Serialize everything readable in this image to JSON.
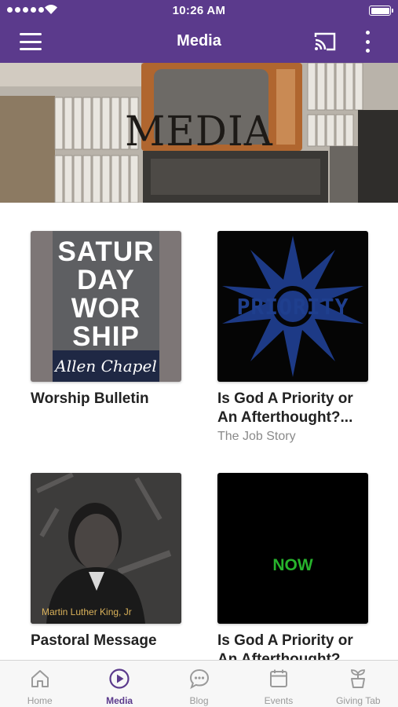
{
  "status_bar": {
    "time": "10:26 AM"
  },
  "nav": {
    "title": "Media",
    "menu_icon": "hamburger-menu-icon",
    "cast_icon": "cast-icon",
    "more_icon": "more-vertical-icon"
  },
  "banner": {
    "title": "MEDIA"
  },
  "items": [
    {
      "title": "Worship Bulletin",
      "subtitle": "",
      "thumb": {
        "line1": "SATUR",
        "line2": "DAY",
        "line3": "WOR",
        "line4": "SHIP",
        "caption": "Allen Chapel"
      }
    },
    {
      "title": "Is God A Priority or An Afterthought?...",
      "subtitle": "The Job Story",
      "thumb": {
        "word": "PRIORITY"
      }
    },
    {
      "title": "Pastoral Message",
      "subtitle": "",
      "thumb": {
        "caption": "Martin Luther King, Jr"
      }
    },
    {
      "title": "Is God A Priority or An Afterthought?...",
      "subtitle": "",
      "thumb": {
        "word": "NOW"
      }
    }
  ],
  "tabs": [
    {
      "label": "Home",
      "icon": "home-icon"
    },
    {
      "label": "Media",
      "icon": "play-circle-icon"
    },
    {
      "label": "Blog",
      "icon": "chat-bubble-icon"
    },
    {
      "label": "Events",
      "icon": "calendar-icon"
    },
    {
      "label": "Giving Tab",
      "icon": "plant-pot-icon"
    }
  ],
  "colors": {
    "brand": "#5b3a8c",
    "active_tab": "#5b3a8c",
    "inactive_tab": "#9a9a9a"
  }
}
